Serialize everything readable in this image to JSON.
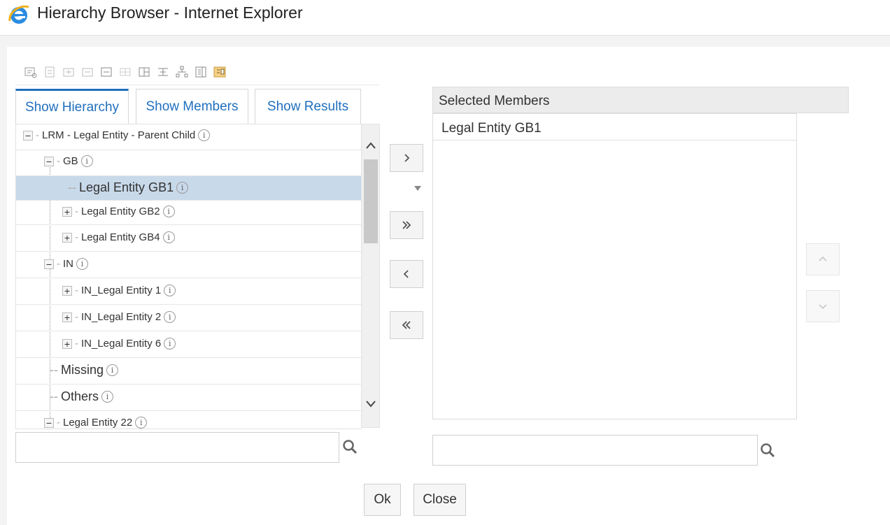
{
  "window": {
    "title": "Hierarchy Browser - Internet Explorer",
    "app_icon": "ie-logo-icon"
  },
  "toolbar": {
    "icons": [
      "expand-all-icon",
      "collapse-icon",
      "expand-branch-icon",
      "collapse-branch-icon",
      "minus-box-icon",
      "grid-icon",
      "split-view-icon",
      "align-icon",
      "tree-structure-icon",
      "list-detail-icon",
      "highlight-grid-icon"
    ]
  },
  "tabs": [
    {
      "label": "Show Hierarchy",
      "active": true
    },
    {
      "label": "Show Members",
      "active": false
    },
    {
      "label": "Show Results",
      "active": false
    }
  ],
  "tree": {
    "nodes": [
      {
        "label": "LRM - Legal Entity - Parent Child",
        "toggle": "−"
      },
      {
        "label": "GB",
        "toggle": "−"
      },
      {
        "label": "Legal Entity GB1",
        "selected": true
      },
      {
        "label": "Legal Entity GB2",
        "toggle": "+"
      },
      {
        "label": "Legal Entity GB4",
        "toggle": "+"
      },
      {
        "label": "IN",
        "toggle": "−"
      },
      {
        "label": "IN_Legal Entity 1",
        "toggle": "+"
      },
      {
        "label": "IN_Legal Entity 2",
        "toggle": "+"
      },
      {
        "label": "IN_Legal Entity 6",
        "toggle": "+"
      },
      {
        "label": "Missing"
      },
      {
        "label": "Others"
      },
      {
        "label": "Legal Entity 22",
        "toggle": "−"
      }
    ],
    "info_glyph": "i"
  },
  "move_buttons": {
    "add": "›",
    "add_all": "»",
    "remove": "‹",
    "remove_all": "«"
  },
  "selected_members": {
    "header": "Selected Members",
    "items": [
      "Legal Entity GB1"
    ]
  },
  "search": {
    "left_value": "",
    "right_value": ""
  },
  "actions": {
    "ok": "Ok",
    "close": "Close"
  },
  "colors": {
    "accent": "#1f6fbe",
    "selection": "#c8d9ea"
  }
}
